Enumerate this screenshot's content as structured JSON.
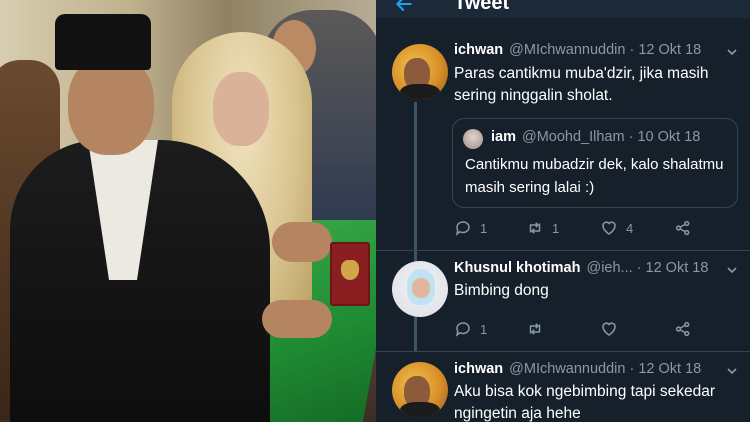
{
  "header": {
    "title": "Tweet",
    "back_icon": "arrow-left-icon"
  },
  "tweets": [
    {
      "name": "ichwan",
      "handle": "@MIchwannuddin",
      "date": "· 12 Okt 18",
      "text": "Paras cantikmu muba'dzir, jika masih sering ninggalin sholat.",
      "quote": {
        "name": "iam",
        "handle": "@Moohd_Ilham",
        "date": "· 10 Okt 18",
        "text": "Cantikmu mubadzir dek, kalo shalatmu masih sering lalai :)"
      },
      "replies": "1",
      "retweets": "1",
      "likes": "4"
    },
    {
      "name": "Khusnul khotimah",
      "handle": "@ieh...",
      "date": "· 12 Okt 18",
      "text": "Bimbing dong",
      "replies": "1",
      "retweets": "",
      "likes": ""
    },
    {
      "name": "ichwan",
      "handle": "@MIchwannuddin",
      "date": "· 12 Okt 18",
      "text": "Aku bisa kok ngebimbing tapi sekedar ngingetin aja hehe"
    }
  ],
  "colors": {
    "background": "#15202b",
    "accent": "#1da1f2",
    "muted": "#8899a6",
    "divider": "#38444d"
  }
}
